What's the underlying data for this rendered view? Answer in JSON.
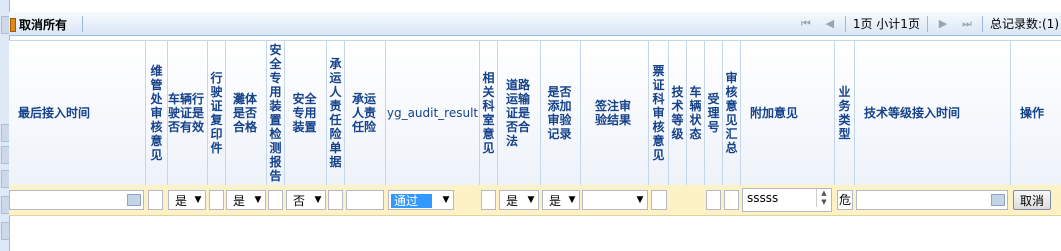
{
  "toolbar": {
    "cancel_all_label": "取消所有"
  },
  "pager": {
    "page_info": "1页 小计1页",
    "total_records": "总记录数:(1)"
  },
  "headers": {
    "last_access_time": "最后接入时间",
    "maintenance_audit_opinion": "维管处审核意见",
    "vehicle_license_valid": "车辆行驶证是否有效",
    "license_copy_stamped": "行驶证复印件",
    "body_qualified": "灘体是否合格",
    "safety_device_report": "安全专用装置检测报告",
    "safety_device": "安全专用装置",
    "carrier_liability_policy": "承运人责任险单据",
    "carrier_liability": "承运人责任险",
    "yg_audit_result": "yg_audit_result",
    "department_opinion": "相关科室意见",
    "transport_permit_legal": "道路运输证是否合法",
    "add_inspection_record": "是否添加审验记录",
    "sign_audit_result": "签注审验结果",
    "ticket_audit_opinion": "票证科审核意见",
    "tech_grade": "技术等级",
    "vehicle_status": "车辆状态",
    "acceptance_no": "受理号",
    "audit_opinion_summary": "审核意见汇总",
    "additional_opinion": "附加意见",
    "business_type": "业务类型",
    "tech_grade_access_time": "技术等级接入时间",
    "operation": "操作"
  },
  "row": {
    "vehicle_license_valid": "是",
    "body_qualified": "是",
    "safety_device": "否",
    "yg_audit_result": "通过",
    "transport_permit_legal": "是",
    "add_inspection_record": "是",
    "additional_opinion": "sssss",
    "business_type": "危",
    "cancel_button": "取消"
  }
}
